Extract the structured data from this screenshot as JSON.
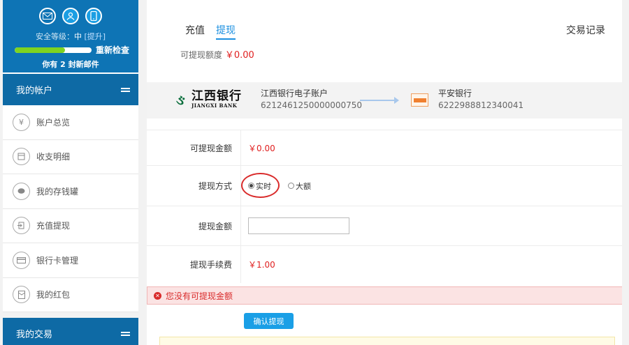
{
  "sidebar": {
    "security_label": "安全等级：",
    "security_level": "中",
    "upgrade_label": "[提升]",
    "security_progress_percent": 65,
    "recheck_label": "重新检查",
    "mail_notice": "你有 2 封新邮件",
    "account_section_title": "我的帐户",
    "items": [
      {
        "label": "账户总览",
        "icon": "yen-icon"
      },
      {
        "label": "收支明细",
        "icon": "ledger-icon"
      },
      {
        "label": "我的存钱罐",
        "icon": "piggy-bank-icon"
      },
      {
        "label": "充值提现",
        "icon": "deposit-withdraw-icon"
      },
      {
        "label": "银行卡管理",
        "icon": "bank-card-icon"
      },
      {
        "label": "我的红包",
        "icon": "red-envelope-icon"
      }
    ],
    "trade_section_title": "我的交易"
  },
  "main": {
    "tabs": [
      {
        "label": "充值",
        "active": false
      },
      {
        "label": "提现",
        "active": true
      }
    ],
    "transaction_link": "交易记录",
    "quota_label": "可提现额度",
    "quota_value": "￥0.00",
    "source_bank": {
      "logo_cn": "江西银行",
      "logo_en": "JIANGXI BANK",
      "name": "江西银行电子账户",
      "account": "6212461250000000750"
    },
    "target_bank": {
      "name": "平安银行",
      "account": "6222988812340041"
    },
    "form": {
      "available_label": "可提现金额",
      "available_value": "￥0.00",
      "method_label": "提现方式",
      "method_options": [
        "实时",
        "大额"
      ],
      "method_selected": "实时",
      "amount_label": "提现金额",
      "amount_value": "",
      "fee_label": "提现手续费",
      "fee_value": "￥1.00"
    },
    "error_message": "您没有可提现金额",
    "confirm_label": "确认提现"
  },
  "colors": {
    "brand_blue": "#0e74b5",
    "accent_blue": "#1a9fe6",
    "error_red": "#e02020",
    "progress_green": "#7ed321"
  }
}
